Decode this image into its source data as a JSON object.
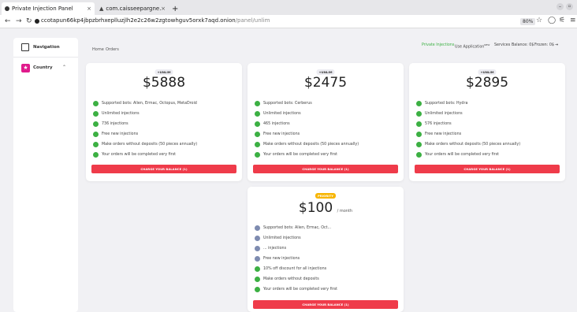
{
  "browser": {
    "tabs": [
      {
        "title": "Private Injection Panel",
        "active": true
      },
      {
        "title": "com.caisseepargne.andr",
        "active": false
      }
    ],
    "new_tab": "+",
    "url_main": "ccotapun66kp4jbpzbrhxeplluzjlh2e2c26w2zgtowhguv5orxk7aqd.onion",
    "url_rest": "/panel/unlim",
    "zoom": "80%"
  },
  "sidebar": {
    "title": "Navigation",
    "country_label": "Country",
    "country_icon": "★"
  },
  "breadcrumb": {
    "home": "Home",
    "current": "Orders"
  },
  "topnav": {
    "private": "Private Injections",
    "use_app": "Use Application",
    "use_app_sup": "NEW",
    "services": "Services",
    "balance": "Balance: 0$",
    "frozen": "Frozen: 0$"
  },
  "colors": {
    "accent_green": "#3cb043",
    "button_red": "#ef3b4a",
    "badge_gold": "#f7b500"
  },
  "plans": [
    {
      "badge": "+UNLIM",
      "price": "$5888",
      "features": [
        "Supported bots: Alien, Ermac, Octopus, MetaDroid",
        "Unlimited injections",
        "736 injections",
        "Free new injections",
        "Make orders without deposits (50 pieces annually)",
        "Your orders will be completed very first"
      ],
      "button": "CHARGE YOUR BALANCE (1)"
    },
    {
      "badge": "+UNLIM",
      "price": "$2475",
      "features": [
        "Supported bots: Cerberus",
        "Unlimited injections",
        "465 injections",
        "Free new injections",
        "Make orders without deposits (50 pieces annually)",
        "Your orders will be completed very first"
      ],
      "button": "CHARGE YOUR BALANCE (1)"
    },
    {
      "badge": "+UNLIM",
      "price": "$2895",
      "features": [
        "Supported bots: Hydra",
        "Unlimited injections",
        "576 injections",
        "Free new injections",
        "Make orders without deposits (50 pieces annually)",
        "Your orders will be completed very first"
      ],
      "button": "CHARGE YOUR BALANCE (1)"
    },
    {
      "badge": "PRIORITY",
      "price": "$100",
      "per": "/ month",
      "features": [
        "Supported bots: Alien, Ermac, Oct...",
        "Unlimited injections",
        "... injections",
        "Free new injections",
        "10% off discount for all injections",
        "Make orders without deposits",
        "Your orders will be completed very first"
      ],
      "button": "CHARGE YOUR BALANCE (1)"
    }
  ]
}
